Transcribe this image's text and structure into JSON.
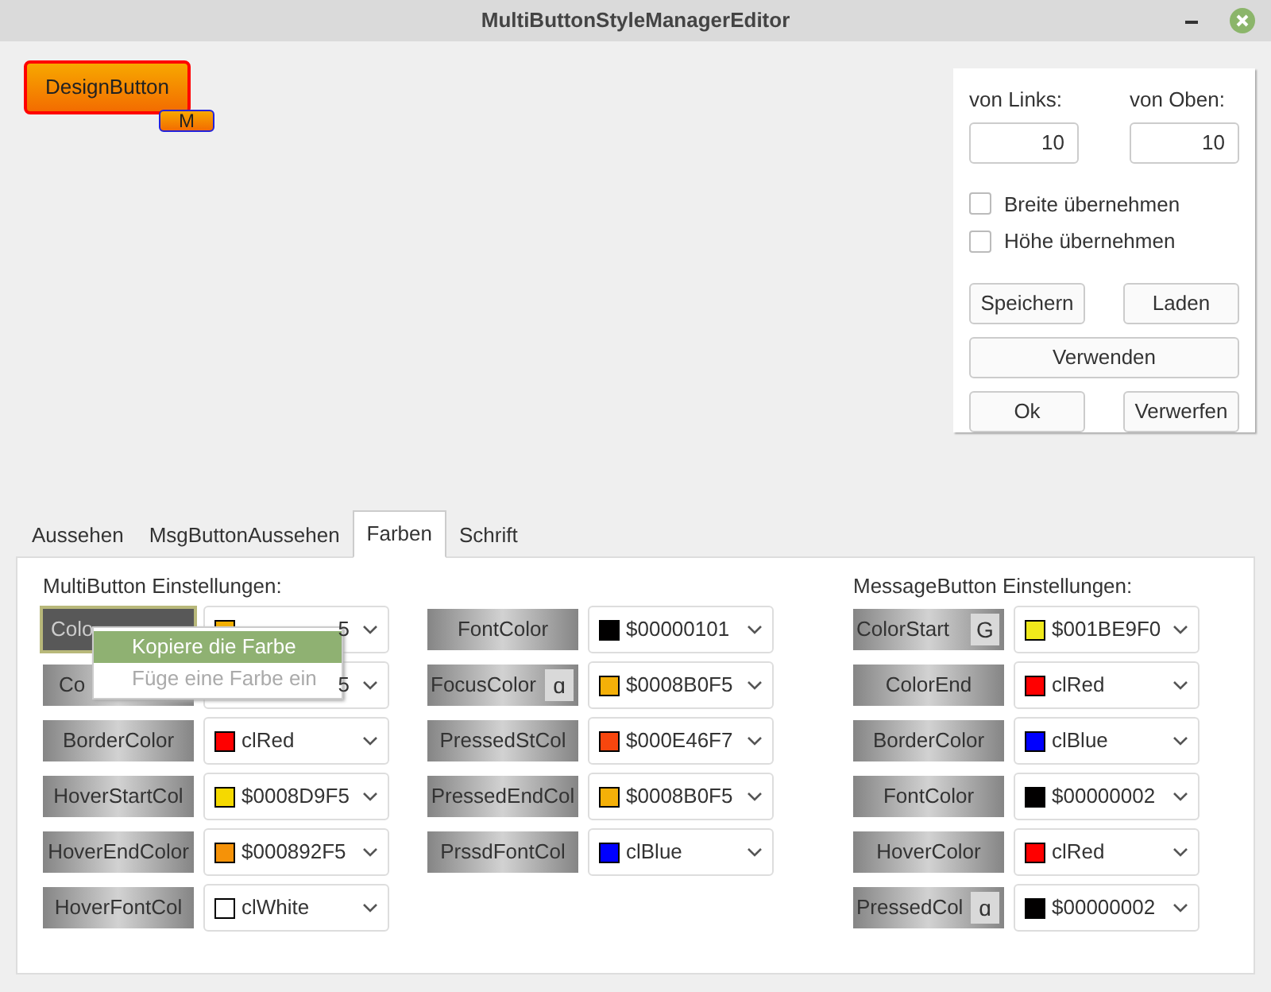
{
  "window": {
    "title": "MultiButtonStyleManagerEditor"
  },
  "preview": {
    "label": "DesignButton",
    "badge": "M"
  },
  "position": {
    "left_label": "von Links:",
    "left_value": "10",
    "top_label": "von Oben:",
    "top_value": "10"
  },
  "checkboxes": [
    {
      "label": "Breite übernehmen",
      "checked": false
    },
    {
      "label": "Höhe übernehmen",
      "checked": false
    }
  ],
  "buttons": [
    "Speichern",
    "Laden",
    "Verwenden",
    "Ok",
    "Verwerfen"
  ],
  "tabs": [
    {
      "label": "Aussehen",
      "selected": false
    },
    {
      "label": "MsgButtonAussehen",
      "selected": false
    },
    {
      "label": "Farben",
      "selected": true
    },
    {
      "label": "Schrift",
      "selected": false
    }
  ],
  "multibutton": {
    "heading": "MultiButton Einstellungen:",
    "columns": [
      [
        {
          "label": "Colo",
          "value": "5",
          "color": "#f5b000",
          "focused": true,
          "covered": true
        },
        {
          "label": "Co",
          "value": "5",
          "focused": false,
          "covered": true
        },
        {
          "label": "BorderColor",
          "value": "clRed",
          "color": "#ff0000",
          "focused": false
        },
        {
          "label": "HoverStartCol",
          "value": "$0008D9F5",
          "color": "#f5d900",
          "focused": false
        },
        {
          "label": "HoverEndColor",
          "value": "$000892F5",
          "color": "#f59208",
          "focused": false
        },
        {
          "label": "HoverFontCol",
          "value": "clWhite",
          "color": "#ffffff",
          "focused": false
        }
      ],
      [
        {
          "label": "FontColor",
          "value": "$00000101",
          "color": "#010000",
          "focused": false
        },
        {
          "label": "FocusColor",
          "value": "$0008B0F5",
          "color": "#f5b008",
          "focused": false,
          "toggle": "ɑ"
        },
        {
          "label": "PressedStCol",
          "value": "$000E46F7",
          "color": "#f7460e",
          "focused": false
        },
        {
          "label": "PressedEndCol",
          "value": "$0008B0F5",
          "color": "#f5b008",
          "focused": false
        },
        {
          "label": "PrssdFontCol",
          "value": "clBlue",
          "color": "#0000ff",
          "focused": false
        }
      ]
    ]
  },
  "messagebutton": {
    "heading": "MessageButton Einstellungen:",
    "rows": [
      {
        "label": "ColorStart",
        "value": "$001BE9F0",
        "color": "#f0e91b",
        "focused": false,
        "toggle": "G"
      },
      {
        "label": "ColorEnd",
        "value": "clRed",
        "color": "#ff0000",
        "focused": false
      },
      {
        "label": "BorderColor",
        "value": "clBlue",
        "color": "#0000ff",
        "focused": false
      },
      {
        "label": "FontColor",
        "value": "$00000002",
        "color": "#020000",
        "focused": false
      },
      {
        "label": "HoverColor",
        "value": "clRed",
        "color": "#ff0000",
        "focused": false
      },
      {
        "label": "PressedCol",
        "value": "$00000002",
        "color": "#020000",
        "focused": false,
        "toggle": "ɑ"
      }
    ]
  },
  "context_menu": {
    "items": [
      {
        "label": "Kopiere die Farbe",
        "selected": true,
        "disabled": false
      },
      {
        "label": "Füge eine Farbe ein",
        "selected": false,
        "disabled": true
      }
    ]
  }
}
